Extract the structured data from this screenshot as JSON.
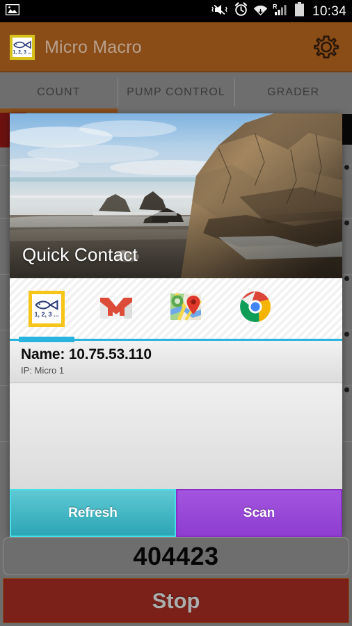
{
  "status_bar": {
    "time": "10:34",
    "icons": {
      "gallery": "image-icon",
      "mute": "vibrate-mute-icon",
      "alarm": "alarm-clock-icon",
      "wifi": "wifi-icon",
      "roaming": "roaming-signal-icon",
      "battery": "battery-icon"
    }
  },
  "app_bar": {
    "title": "Micro Macro",
    "logo_caption": "1, 2, 3 ...",
    "logo_icon": "fish-icon",
    "settings_icon": "gear-icon"
  },
  "tabs": [
    {
      "label": "COUNT",
      "active": true
    },
    {
      "label": "PUMP CONTROL",
      "active": false
    },
    {
      "label": "GRADER",
      "active": false
    }
  ],
  "quick_contact": {
    "title": "Quick Contact",
    "photo_alt": "beach-cliff-photo",
    "apps": [
      {
        "name": "micro-macro",
        "icon": "fish-icon",
        "caption": "1, 2, 3 ...",
        "selected": true
      },
      {
        "name": "gmail",
        "icon": "gmail-icon",
        "selected": false
      },
      {
        "name": "maps",
        "icon": "google-maps-icon",
        "selected": false
      },
      {
        "name": "chrome",
        "icon": "chrome-icon",
        "selected": false
      }
    ],
    "name_line": "Name: 10.75.53.110",
    "sub_line": "IP: Micro 1"
  },
  "actions": {
    "refresh_label": "Refresh",
    "scan_label": "Scan"
  },
  "counter": {
    "value": "404423"
  },
  "stop": {
    "label": "Stop"
  },
  "colors": {
    "app_bar": "#8a4d18",
    "tab_indicator": "#8a4d18",
    "refresh": "#2da5b4",
    "scan": "#8e3dcf",
    "stop": "#7b2119",
    "selection": "#28b4de",
    "logo_border": "#f5c518"
  }
}
